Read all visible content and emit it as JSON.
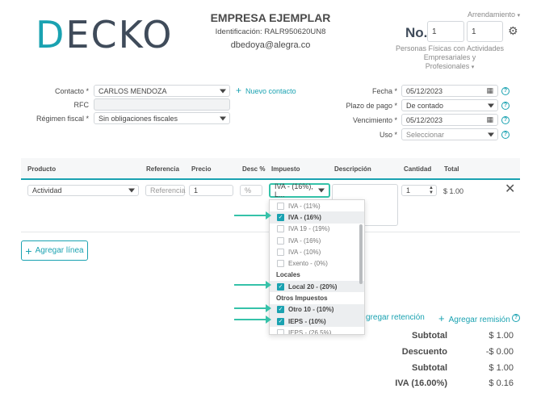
{
  "logo": {
    "first": "D",
    "rest": "ECKO"
  },
  "company": {
    "name": "EMPRESA EJEMPLAR",
    "identification": "Identificación: RALR950620UN8",
    "email": "dbedoya@alegra.co"
  },
  "header": {
    "regime_select": "Arrendamiento",
    "no_label": "No.",
    "no_value_1": "1",
    "no_value_2": "1",
    "regime_line_1": "Personas Físicas con Actividades Empresariales y",
    "regime_line_2": "Profesionales"
  },
  "form": {
    "contact_label": "Contacto *",
    "contact_value": "CARLOS MENDOZA",
    "new_contact": "Nuevo contacto",
    "rfc_label": "RFC",
    "rfc_value": "",
    "regime_label": "Régimen fiscal *",
    "regime_value": "Sin obligaciones fiscales",
    "date_label": "Fecha *",
    "date_value": "05/12/2023",
    "term_label": "Plazo de pago *",
    "term_value": "De contado",
    "due_label": "Vencimiento *",
    "due_value": "05/12/2023",
    "use_label": "Uso *",
    "use_placeholder": "Seleccionar"
  },
  "table": {
    "columns": [
      "Producto",
      "Referencia",
      "Precio",
      "Desc %",
      "Impuesto",
      "Descripción",
      "Cantidad",
      "Total"
    ],
    "row": {
      "product": "Actividad",
      "reference_placeholder": "Referencia",
      "price": "1",
      "discount_placeholder": "%",
      "tax": "IVA - (16%), L...",
      "quantity": "1",
      "total": "$ 1.00"
    }
  },
  "tax_dropdown": {
    "items": [
      {
        "label": "IVA - (11%)",
        "checked": false,
        "type": "option"
      },
      {
        "label": "IVA - (16%)",
        "checked": true,
        "type": "option"
      },
      {
        "label": "IVA 19 - (19%)",
        "checked": false,
        "type": "option"
      },
      {
        "label": "IVA - (16%)",
        "checked": false,
        "type": "option"
      },
      {
        "label": "IVA - (10%)",
        "checked": false,
        "type": "option"
      },
      {
        "label": "Exento - (0%)",
        "checked": false,
        "type": "option"
      },
      {
        "label": "Locales",
        "type": "group"
      },
      {
        "label": "Local 20 - (20%)",
        "checked": true,
        "type": "option"
      },
      {
        "label": "Otros Impuestos",
        "type": "group"
      },
      {
        "label": "Otro 10 - (10%)",
        "checked": true,
        "type": "option"
      },
      {
        "label": "IEPS - (10%)",
        "checked": true,
        "type": "option"
      },
      {
        "label": "IEPS - (26.5%)",
        "checked": false,
        "type": "option"
      }
    ]
  },
  "actions": {
    "add_line": "Agregar línea",
    "add_retention": "gregar retención",
    "add_remission": "Agregar remisión"
  },
  "totals": [
    {
      "label": "Subtotal",
      "value": "$ 1.00"
    },
    {
      "label": "Descuento",
      "value": "-$ 0.00"
    },
    {
      "label": "Subtotal",
      "value": "$ 1.00"
    },
    {
      "label": "IVA (16.00%)",
      "value": "$ 0.16"
    }
  ],
  "colors": {
    "accent": "#1aa2b1",
    "pointer": "#35c2a9",
    "text": "#4a4a4a"
  }
}
